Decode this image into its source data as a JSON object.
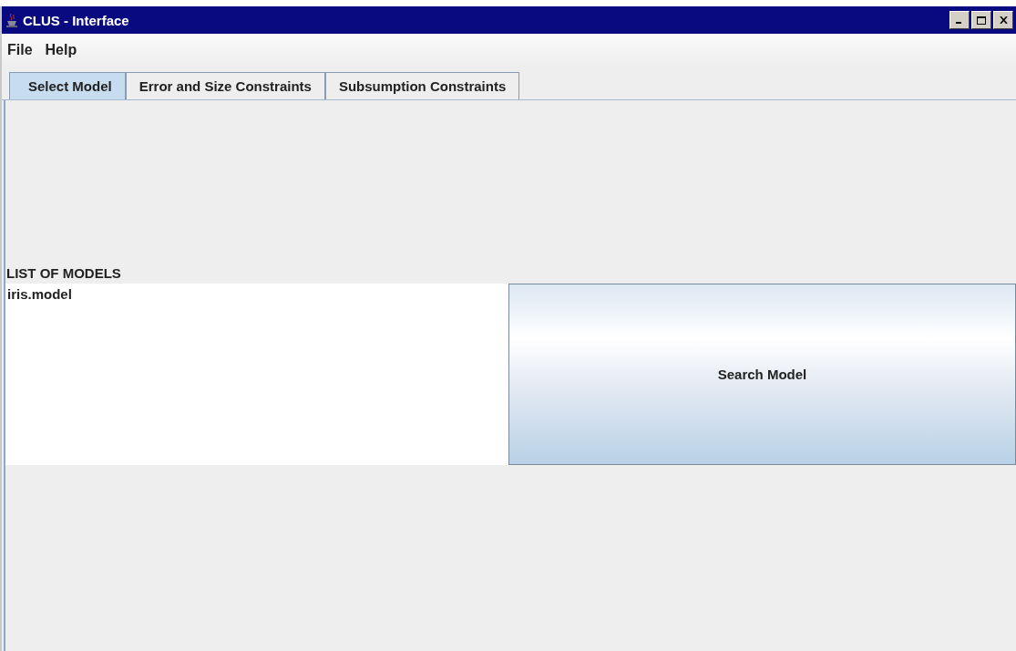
{
  "window": {
    "title": "CLUS - Interface"
  },
  "menu": [
    "File",
    "Help"
  ],
  "tabs": [
    {
      "label": "Select Model",
      "selected": true
    },
    {
      "label": "Error and Size Constraints",
      "selected": false
    },
    {
      "label": "Subsumption Constraints",
      "selected": false
    }
  ],
  "models_label": "LIST OF MODELS",
  "models": [
    {
      "name": "iris.model",
      "selected": false
    }
  ],
  "search_button": "Search Model"
}
